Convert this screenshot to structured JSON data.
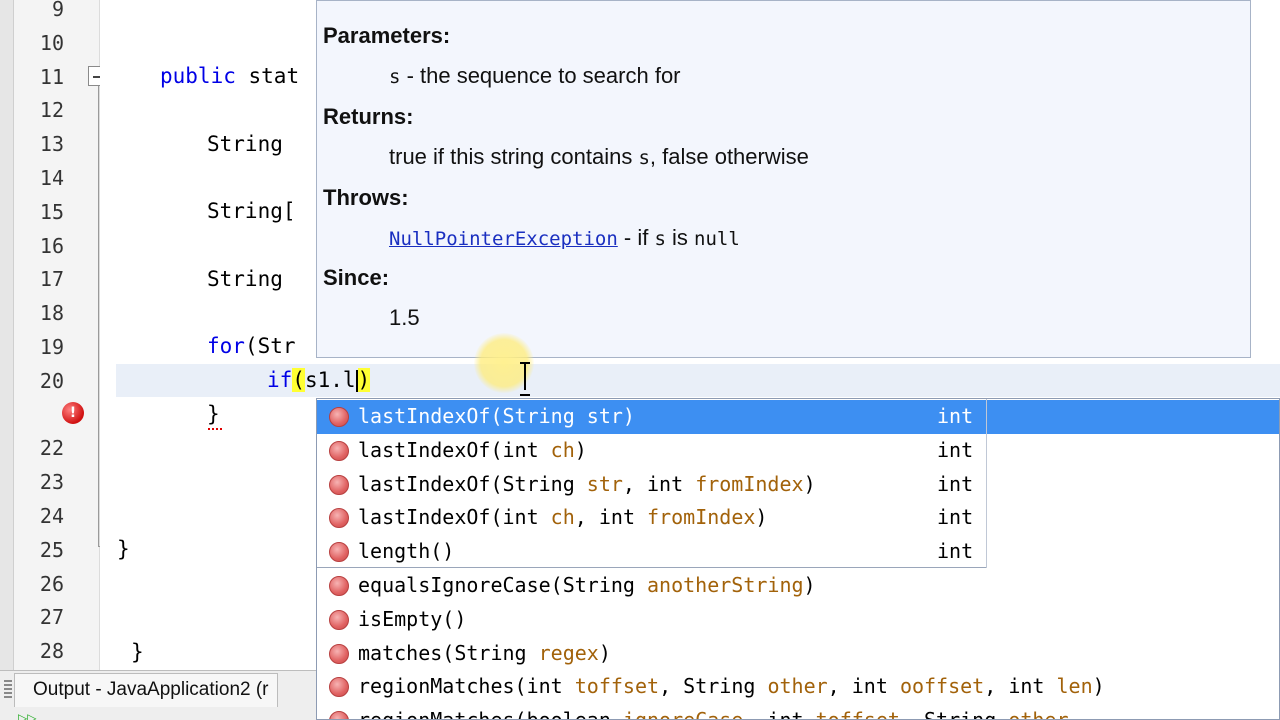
{
  "gutter": {
    "line_numbers": [
      "9",
      "10",
      "11",
      "12",
      "13",
      "14",
      "15",
      "16",
      "17",
      "18",
      "19",
      "20",
      "",
      "22",
      "23",
      "24",
      "25",
      "26",
      "27",
      "28"
    ]
  },
  "code": {
    "line11_keyword": "public",
    "line11_rest": "stat",
    "line13": "String ",
    "line15": "String[",
    "line17": "String ",
    "line19_keyword": "for",
    "line19_rest": "(Str",
    "line20_keyword": "if",
    "line20_open": "(",
    "line20_expr": "s1.l",
    "line20_close": ")",
    "line21": "}",
    "line25": "}",
    "line28": "}"
  },
  "javadoc": {
    "parameters_heading": "Parameters:",
    "param_name": "s",
    "param_desc": " - the sequence to search for",
    "returns_heading": "Returns:",
    "returns_pre": "true if this string contains ",
    "returns_code": "s",
    "returns_post": ", false otherwise",
    "throws_heading": "Throws:",
    "throws_link": "NullPointerException",
    "throws_mid": " - if ",
    "throws_code1": "s",
    "throws_is": " is ",
    "throws_code2": "null",
    "since_heading": "Since:",
    "since_value": "1.5"
  },
  "completion": {
    "items": [
      {
        "method": "lastIndexOf",
        "open": "(",
        "params": [
          [
            "String",
            "str"
          ]
        ],
        "close": ")",
        "return": "int",
        "selected": true
      },
      {
        "method": "lastIndexOf",
        "open": "(",
        "params": [
          [
            "int",
            "ch"
          ]
        ],
        "close": ")",
        "return": "int",
        "selected": false
      },
      {
        "method": "lastIndexOf",
        "open": "(",
        "params": [
          [
            "String",
            "str"
          ],
          [
            "int",
            "fromIndex"
          ]
        ],
        "close": ")",
        "return": "int",
        "selected": false
      },
      {
        "method": "lastIndexOf",
        "open": "(",
        "params": [
          [
            "int",
            "ch"
          ],
          [
            "int",
            "fromIndex"
          ]
        ],
        "close": ")",
        "return": "int",
        "selected": false
      },
      {
        "method": "length",
        "open": "(",
        "params": [],
        "close": ")",
        "return": "int",
        "selected": false
      },
      {
        "method": "equalsIgnoreCase",
        "open": "(",
        "params": [
          [
            "String",
            "anotherString"
          ]
        ],
        "close": ")",
        "return": "",
        "selected": false
      },
      {
        "method": "isEmpty",
        "open": "(",
        "params": [],
        "close": ")",
        "return": "",
        "selected": false
      },
      {
        "method": "matches",
        "open": "(",
        "params": [
          [
            "String",
            "regex"
          ]
        ],
        "close": ")",
        "return": "",
        "selected": false
      },
      {
        "method": "regionMatches",
        "open": "(",
        "params": [
          [
            "int",
            "toffset"
          ],
          [
            "String",
            "other"
          ],
          [
            "int",
            "ooffset"
          ],
          [
            "int",
            "len"
          ]
        ],
        "close": ")",
        "return": "",
        "selected": false
      },
      {
        "method": "regionMatches",
        "open": "(",
        "params": [
          [
            "boolean",
            "ignoreCase"
          ],
          [
            "int",
            "toffset"
          ],
          [
            "String",
            "other"
          ]
        ],
        "close": "",
        "return": "",
        "selected": false
      }
    ]
  },
  "output": {
    "tab_label": "Output - JavaApplication2 (r"
  },
  "colors": {
    "keyword": "#0000e6",
    "param_name": "#a2620a",
    "selection": "#3d8ff2",
    "javadoc_bg": "#f3f6fd",
    "error": "#d01010"
  }
}
